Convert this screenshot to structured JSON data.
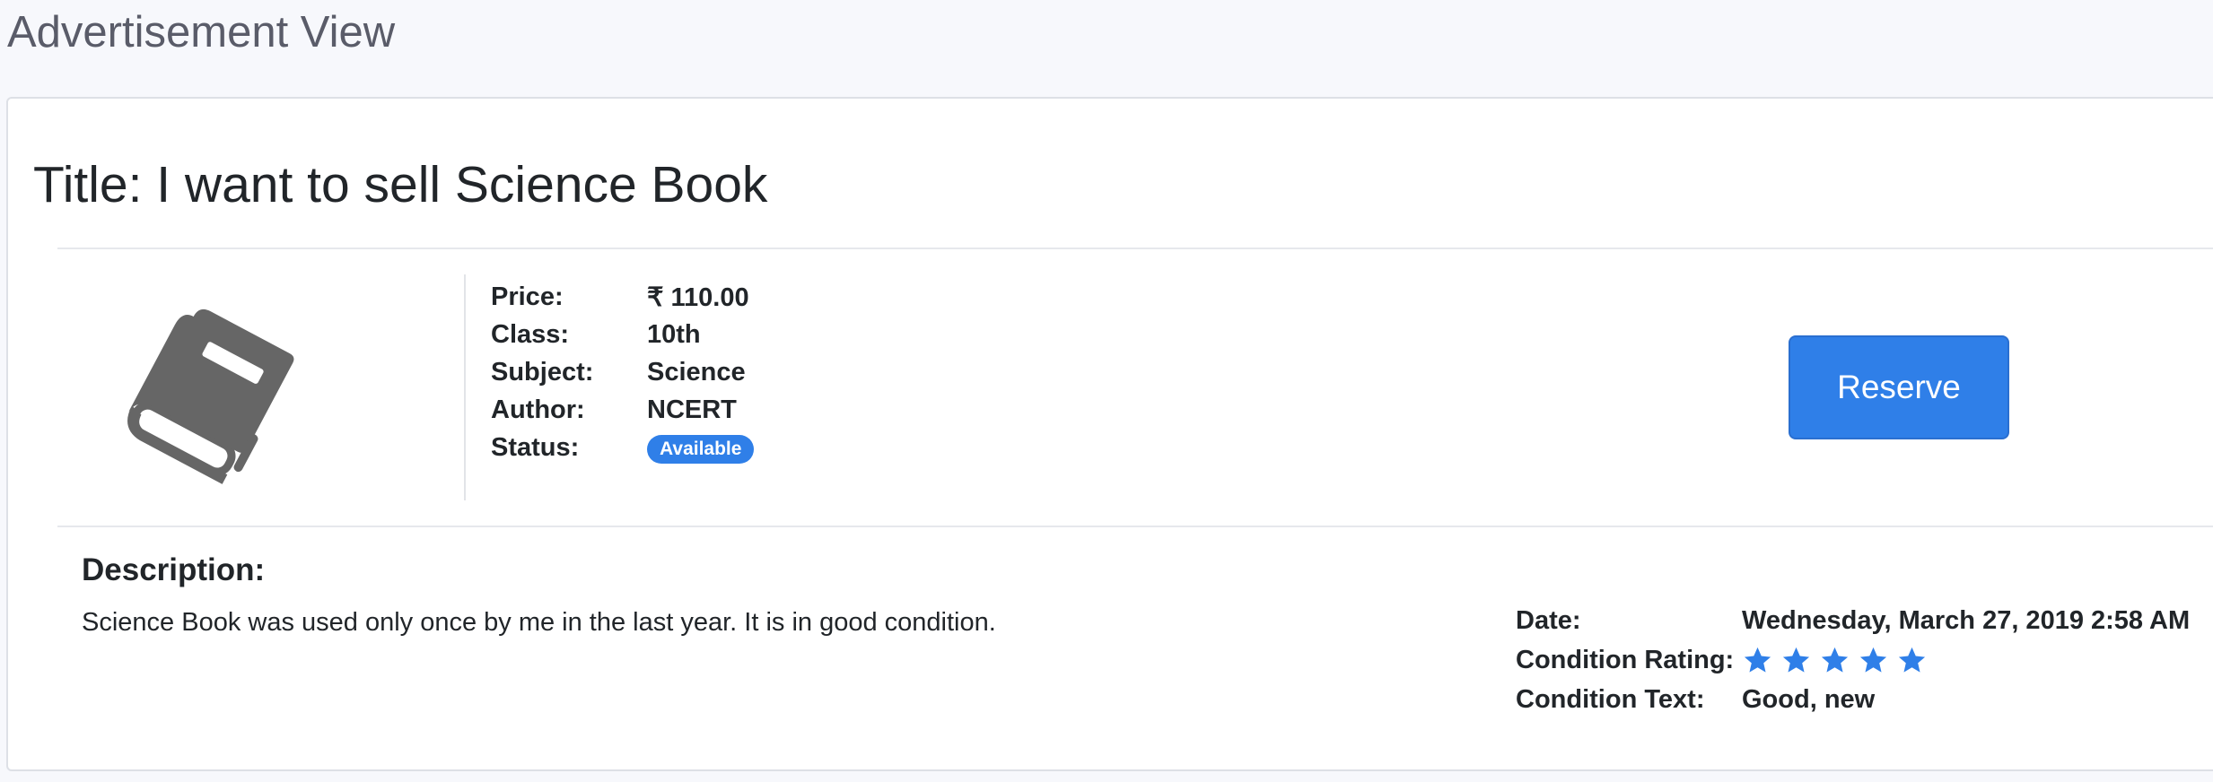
{
  "page": {
    "title": "Advertisement View"
  },
  "ad": {
    "title": "Title: I want to sell Science Book",
    "icon": "book-icon",
    "reserve_label": "Reserve",
    "specs": {
      "price_label": "Price:",
      "price_value": "₹ 110.00",
      "class_label": "Class:",
      "class_value": "10th",
      "subject_label": "Subject:",
      "subject_value": "Science",
      "author_label": "Author:",
      "author_value": "NCERT",
      "status_label": "Status:",
      "status_value": "Available"
    },
    "description": {
      "heading": "Description:",
      "text": "Science Book was used only once by me in the last year. It is in good condition."
    },
    "meta": {
      "date_label": "Date:",
      "date_value": "Wednesday, March 27, 2019 2:58 AM",
      "rating_label": "Condition Rating:",
      "rating_value": 5,
      "rating_max": 5,
      "condition_label": "Condition Text:",
      "condition_value": "Good, new"
    }
  },
  "colors": {
    "accent": "#2f7fe8",
    "icon_gray": "#666666",
    "title_gray": "#5a5c69"
  }
}
